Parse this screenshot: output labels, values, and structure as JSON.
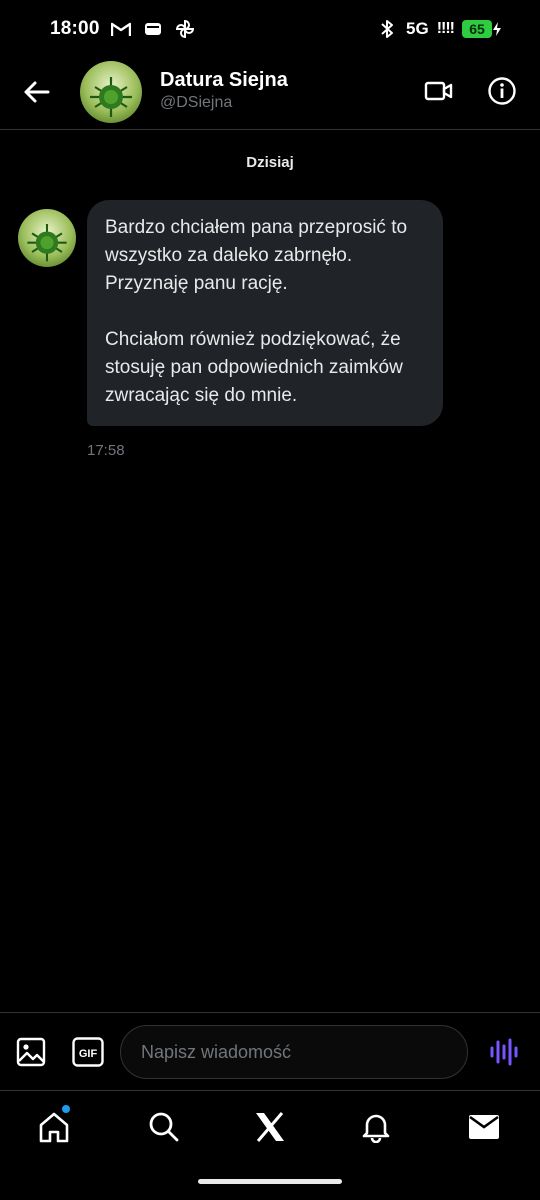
{
  "status_bar": {
    "time": "18:00",
    "network": "5G",
    "signal": "!!!!",
    "battery": "65"
  },
  "header": {
    "name": "Datura Siejna",
    "handle": "@DSiejna"
  },
  "chat": {
    "day_label": "Dzisiaj",
    "messages": [
      {
        "text": "Bardzo chciałem pana przeprosić to wszystko za daleko zabrnęło. Przyznaję panu rację.\n\nChciałom również podziękować, że stosuję pan odpowiednich zaimków zwracając się do mnie.",
        "time": "17:58"
      }
    ]
  },
  "composer": {
    "placeholder": "Napisz wiadomość",
    "gif_label": "GIF"
  },
  "colors": {
    "background": "#000000",
    "bubble": "#202327",
    "accent": "#1d9bf0",
    "voice": "#7856ff",
    "battery": "#2ecc40"
  },
  "icons": [
    "back-arrow-icon",
    "video-camera-icon",
    "info-icon",
    "image-icon",
    "gif-icon",
    "voice-wave-icon",
    "home-icon",
    "search-icon",
    "x-logo-icon",
    "bell-icon",
    "mail-icon"
  ]
}
